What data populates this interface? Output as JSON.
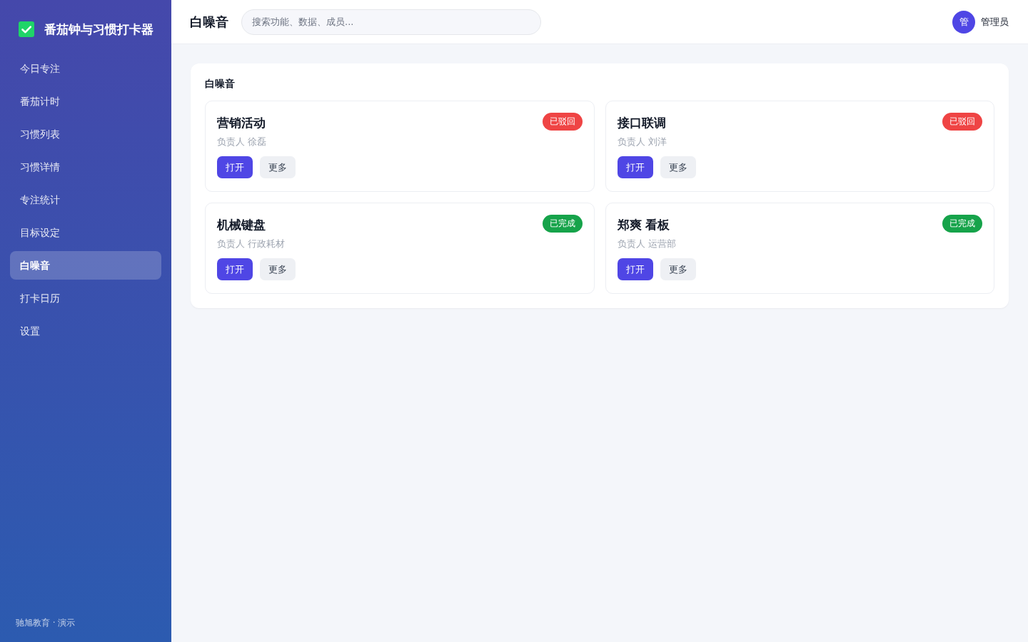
{
  "sidebar": {
    "brand": "番茄钟与习惯打卡器",
    "items": [
      {
        "label": "今日专注",
        "selected": false
      },
      {
        "label": "番茄计时",
        "selected": false
      },
      {
        "label": "习惯列表",
        "selected": false
      },
      {
        "label": "习惯详情",
        "selected": false
      },
      {
        "label": "专注统计",
        "selected": false
      },
      {
        "label": "目标设定",
        "selected": false
      },
      {
        "label": "白噪音",
        "selected": true
      },
      {
        "label": "打卡日历",
        "selected": false
      },
      {
        "label": "设置",
        "selected": false
      }
    ],
    "footer": "驰旭教育 · 演示"
  },
  "header": {
    "title": "白噪音",
    "search": {
      "placeholder": "搜索功能、数据、成员..."
    },
    "user": {
      "avatar": "管",
      "name": "管理员"
    }
  },
  "panel": {
    "title": "白噪音",
    "cards": [
      {
        "title": "营销活动",
        "owner": "负责人 徐磊",
        "status": {
          "label": "已驳回",
          "color": "#ef4444"
        },
        "actions": [
          {
            "label": "打开",
            "kind": "primary"
          },
          {
            "label": "更多",
            "kind": "secondary"
          }
        ]
      },
      {
        "title": "接口联调",
        "owner": "负责人 刘洋",
        "status": {
          "label": "已驳回",
          "color": "#ef4444"
        },
        "actions": [
          {
            "label": "打开",
            "kind": "primary"
          },
          {
            "label": "更多",
            "kind": "secondary"
          }
        ]
      },
      {
        "title": "机械键盘",
        "owner": "负责人 行政耗材",
        "status": {
          "label": "已完成",
          "color": "#16a34a"
        },
        "actions": [
          {
            "label": "打开",
            "kind": "primary"
          },
          {
            "label": "更多",
            "kind": "secondary"
          }
        ]
      },
      {
        "title": "郑爽 看板",
        "owner": "负责人 运营部",
        "status": {
          "label": "已完成",
          "color": "#16a34a"
        },
        "actions": [
          {
            "label": "打开",
            "kind": "primary"
          },
          {
            "label": "更多",
            "kind": "secondary"
          }
        ]
      }
    ]
  }
}
